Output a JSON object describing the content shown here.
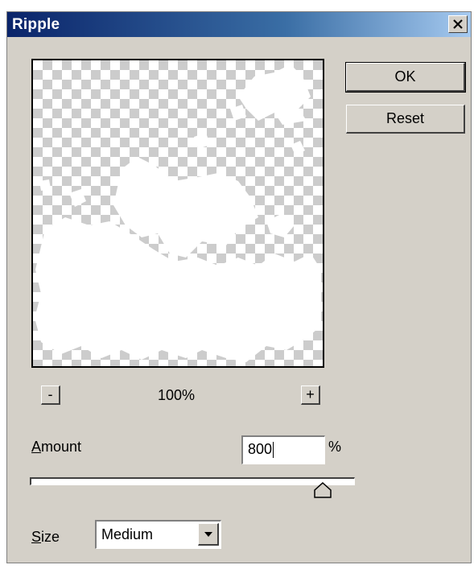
{
  "window": {
    "title": "Ripple",
    "close_icon": "close-icon"
  },
  "buttons": {
    "ok_label": "OK",
    "reset_label": "Reset"
  },
  "zoom": {
    "minus_label": "-",
    "plus_label": "+",
    "level": "100%"
  },
  "amount": {
    "label_key": "A",
    "label_rest": "mount",
    "value": "800",
    "unit": "%",
    "slider_fraction": 0.9
  },
  "size": {
    "label_key": "S",
    "label_rest": "ize",
    "value": "Medium",
    "arrow_icon": "chevron-down-icon"
  },
  "colors": {
    "dialog_bg": "#d4d0c8",
    "titlebar_start": "#0a246a",
    "titlebar_end": "#a6caf0"
  }
}
